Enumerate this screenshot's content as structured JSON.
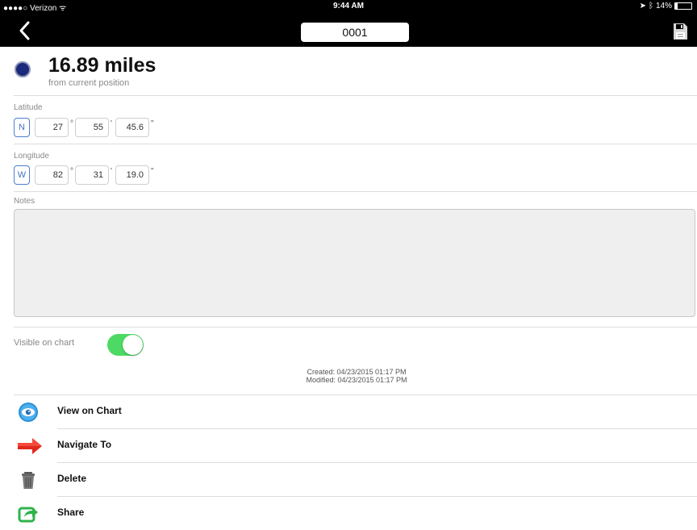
{
  "status_bar": {
    "carrier": "●●●●○ Verizon ᯤ",
    "time": "9:44 AM",
    "battery": "14%"
  },
  "nav": {
    "title": "0001",
    "back_icon": "chevron-left-icon",
    "save_icon": "floppy-disk-icon"
  },
  "distance": {
    "value": "16.89 miles",
    "subtitle": "from current position",
    "dot_color": "#1b2a7a"
  },
  "latitude": {
    "label": "Latitude",
    "hemisphere": "N",
    "degrees": "27",
    "minutes": "55",
    "seconds": "45.6"
  },
  "longitude": {
    "label": "Longitude",
    "hemisphere": "W",
    "degrees": "82",
    "minutes": "31",
    "seconds": "19.0"
  },
  "units": {
    "degree": "°",
    "minute": "'",
    "second": "\""
  },
  "notes": {
    "label": "Notes",
    "value": ""
  },
  "visibility": {
    "label": "Visible on chart",
    "enabled": true,
    "accent": "#4cd964"
  },
  "timestamps": {
    "created": "Created: 04/23/2015 01:17 PM",
    "modified": "Modified: 04/23/2015 01:17 PM"
  },
  "actions": [
    {
      "label": "View on Chart",
      "icon": "eye-icon"
    },
    {
      "label": "Navigate To",
      "icon": "arrow-right-icon"
    },
    {
      "label": "Delete",
      "icon": "trash-icon"
    },
    {
      "label": "Share",
      "icon": "share-icon"
    }
  ]
}
